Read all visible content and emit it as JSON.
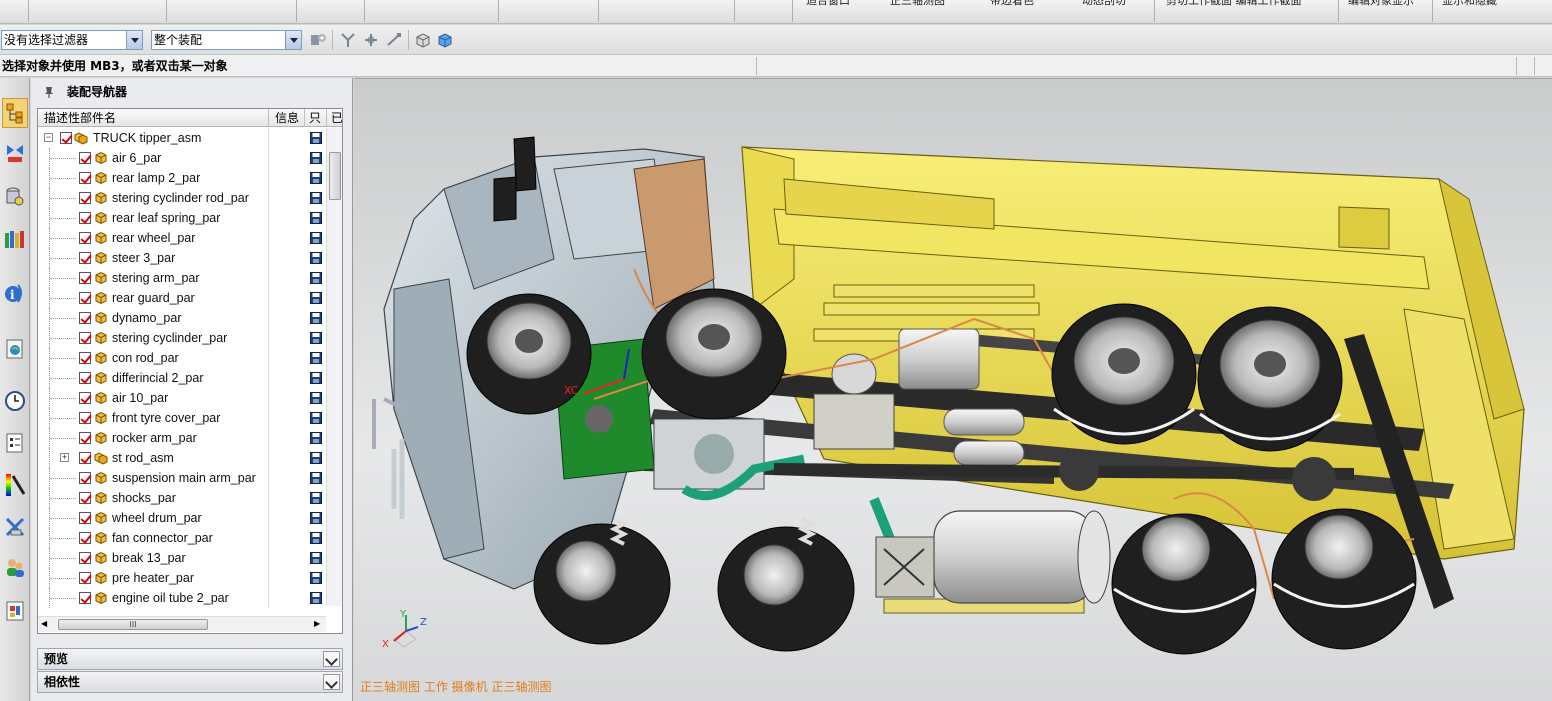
{
  "top_toolbar": {
    "commands": [
      "适合窗口",
      "正三轴测图",
      "带边着色",
      "动态剖切",
      "剪切工作截面  编辑工作截面",
      "编辑对象显示",
      "显示和隐藏"
    ]
  },
  "filter_bar": {
    "selection_filter": "没有选择过滤器",
    "assembly_scope": "整个装配"
  },
  "prompt": "选择对象并使用 MB3，或者双击某一对象",
  "resource_bar": {
    "icons": [
      "assembly-navigator-icon",
      "constraint-navigator-icon",
      "part-navigator-icon",
      "reuse-library-icon",
      "hd3d-tools-icon",
      "web-browser-icon",
      "history-icon",
      "process-studio-icon",
      "visualization-icon",
      "role-icon",
      "system-materials-icon",
      "palette-icon"
    ]
  },
  "navigator": {
    "title": "装配导航器",
    "columns": {
      "name": "描述性部件名",
      "info": "信息",
      "readonly": "只",
      "extra": "已"
    },
    "root": "TRUCK tipper_asm",
    "items": [
      {
        "label": "air 6_par",
        "type": "part"
      },
      {
        "label": "rear lamp 2_par",
        "type": "part"
      },
      {
        "label": "stering cyclinder rod_par",
        "type": "part"
      },
      {
        "label": "rear leaf spring_par",
        "type": "part"
      },
      {
        "label": "rear wheel_par",
        "type": "part"
      },
      {
        "label": "steer 3_par",
        "type": "part"
      },
      {
        "label": "stering arm_par",
        "type": "part"
      },
      {
        "label": "rear guard_par",
        "type": "part"
      },
      {
        "label": "dynamo_par",
        "type": "part"
      },
      {
        "label": "stering cyclinder_par",
        "type": "part"
      },
      {
        "label": "con rod_par",
        "type": "part"
      },
      {
        "label": "differincial 2_par",
        "type": "part"
      },
      {
        "label": "air 10_par",
        "type": "part"
      },
      {
        "label": "front tyre cover_par",
        "type": "part"
      },
      {
        "label": "rocker arm_par",
        "type": "part"
      },
      {
        "label": "st rod_asm",
        "type": "assembly"
      },
      {
        "label": "suspension main arm_par",
        "type": "part"
      },
      {
        "label": "shocks_par",
        "type": "part"
      },
      {
        "label": "wheel drum_par",
        "type": "part"
      },
      {
        "label": "fan connector_par",
        "type": "part"
      },
      {
        "label": "break 13_par",
        "type": "part"
      },
      {
        "label": "pre heater_par",
        "type": "part"
      },
      {
        "label": "engine oil tube 2_par",
        "type": "part"
      }
    ],
    "scroll_label": "III",
    "panes": {
      "preview": "预览",
      "dependencies": "相依性"
    }
  },
  "viewport": {
    "label": "正三轴测图 工作 摄像机 正三轴测图",
    "triad": {
      "x": "X",
      "y": "Y",
      "z": "Z",
      "xc": "XC"
    }
  },
  "colors": {
    "tipper_body": "#f2e04a",
    "cab": "#b9c6cf",
    "tyre": "#1f1f1f",
    "accent_label": "#e07b1c",
    "check_mark": "#dd0000"
  }
}
